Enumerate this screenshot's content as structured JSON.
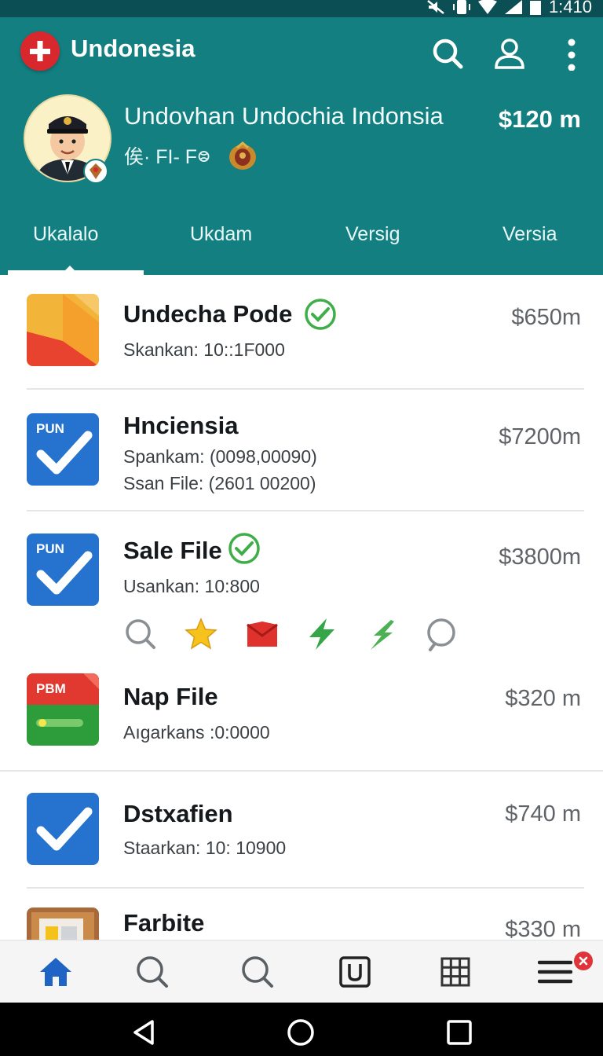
{
  "status_bar": {
    "time": "1:410"
  },
  "app": {
    "title": "Undonesia"
  },
  "profile": {
    "name": "Undovhan Undochia Indonsia",
    "subtitle": "俟· FI- F᳂",
    "amount": "$120 m"
  },
  "tabs": [
    {
      "label": "Ukalalo",
      "active": true
    },
    {
      "label": "Ukdam"
    },
    {
      "label": "Versig"
    },
    {
      "label": "Versia"
    }
  ],
  "items": [
    {
      "title": "Undecha Pode",
      "lines": [
        "Skankan: 10::1F000"
      ],
      "price": "$650m",
      "verified": true,
      "icon": "orange-doc-icon",
      "icon_label": ""
    },
    {
      "title": "Hnciensia",
      "lines": [
        "Spankam: (0098,00090)",
        "Ssan File: (2601 00200)"
      ],
      "price": "$7200m",
      "verified": false,
      "icon": "blue-check-doc-icon",
      "icon_label": "PUN"
    },
    {
      "title": "Sale File",
      "lines": [
        "Usankan: 10:800"
      ],
      "price": "$3800m",
      "verified": true,
      "icon": "blue-check-doc-icon",
      "icon_label": "PUN"
    },
    {
      "title": "Nap File",
      "lines": [
        "Aıgarkans :0:0000"
      ],
      "price": "$320 m",
      "verified": false,
      "icon": "green-doc-icon",
      "icon_label": "PBM"
    },
    {
      "title": "Dstxafien",
      "lines": [
        "Staarkan: 10: 10900"
      ],
      "price": "$740 m",
      "verified": false,
      "icon": "blue-check-doc-icon",
      "icon_label": ""
    },
    {
      "title": "Farbite",
      "lines": [],
      "price": "$330 m",
      "verified": false,
      "icon": "box-icon",
      "icon_label": ""
    }
  ],
  "quick_actions": [
    "search-icon",
    "star-icon",
    "mail-icon",
    "bolt-icon",
    "bolt-icon",
    "search-icon"
  ],
  "bottom_nav": [
    "home-icon",
    "search-icon",
    "search-icon",
    "widget-icon",
    "grid-icon",
    "menu-icon"
  ],
  "colors": {
    "header": "#137f80",
    "status": "#0b4f55",
    "accent": "#1f64c4",
    "check_green": "#3fae4a"
  }
}
